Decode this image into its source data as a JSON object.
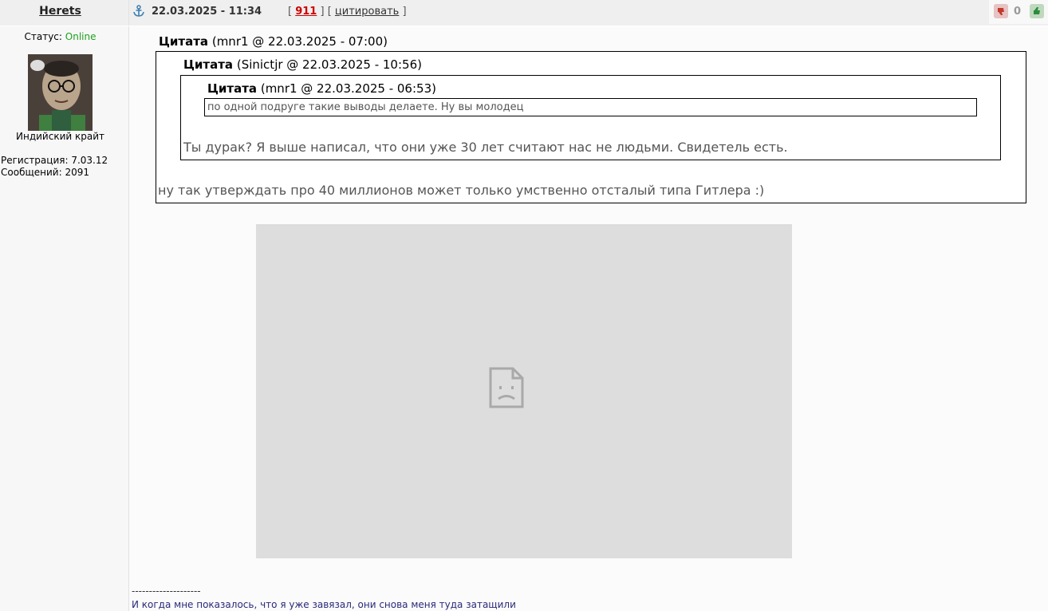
{
  "author": {
    "username": "Herets",
    "status_label": "Статус:",
    "status_value": "Online",
    "rank": "Индийский крайт",
    "registration": "Регистрация: 7.03.12",
    "messages": "Сообщений: 2091"
  },
  "post": {
    "datetime": "22.03.2025 - 11:34",
    "bracket_open": "[",
    "post_number": "911",
    "bracket_mid": "] [",
    "quote_label": "цитировать",
    "bracket_close": "]",
    "rating": "0"
  },
  "quotes": {
    "outer": {
      "label": "Цитата",
      "meta": "(mnr1 @ 22.03.2025 - 07:00)",
      "text": "ну так утверждать про 40 миллионов может только умственно отсталый типа Гитлера :)"
    },
    "middle": {
      "label": "Цитата",
      "meta": "(Sinictjr @ 22.03.2025 - 10:56)",
      "text": "Ты дурак? Я выше написал, что они уже 30 лет считают нас не людьми. Свидетель есть."
    },
    "inner": {
      "label": "Цитата",
      "meta": "(mnr1 @ 22.03.2025 - 06:53)",
      "text": "по одной подруге такие выводы делаете. Ну вы молодец"
    }
  },
  "signature": {
    "separator": "--------------------",
    "text": "И когда мне показалось, что я уже завязал, они снова меня туда затащили"
  },
  "icons": {
    "anchor": "anchor-icon",
    "thumb_down": "thumb-down-icon",
    "thumb_up": "thumb-up-icon",
    "broken_image": "broken-image-icon"
  },
  "colors": {
    "online": "#1fa01f",
    "post_number": "#cc0000",
    "signature": "#2a2a7a"
  }
}
